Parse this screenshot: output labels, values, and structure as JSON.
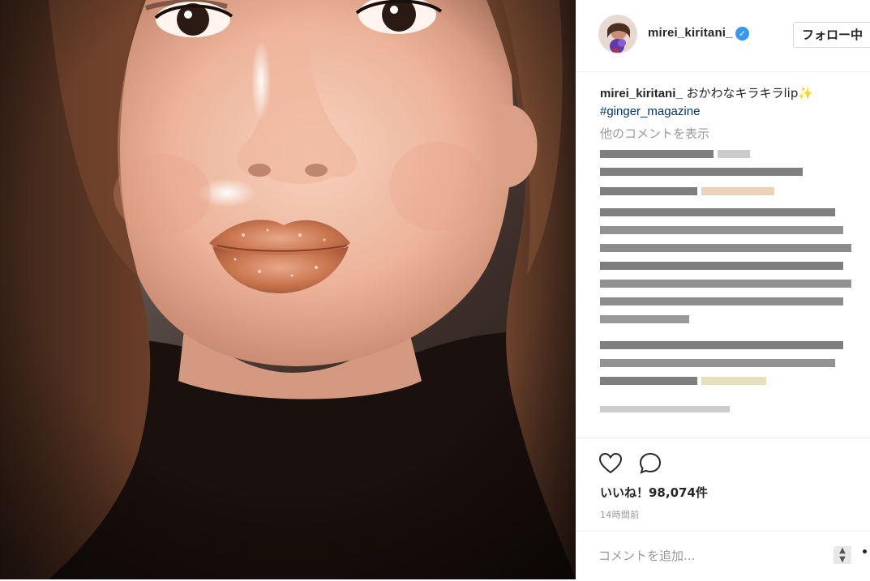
{
  "post": {
    "author": "mirei_kiritani_",
    "verified": true,
    "follow_label": "フォロー中",
    "caption_user": "mirei_kiritani_",
    "caption_text": " おかわなキラキラlip✨",
    "hashtag": "#ginger_magazine",
    "more_comments": "他のコメントを表示",
    "likes_label": "いいね！98,074件",
    "time": "14時間前",
    "add_comment_placeholder": "コメントを追加...",
    "more_options": "•••"
  },
  "icons": {
    "like": "heart-icon",
    "comment": "comment-bubble-icon",
    "verified": "verified-check-icon",
    "stepper": "stepper-arrows-icon"
  },
  "colors": {
    "link": "#003569",
    "verified": "#3897f0",
    "muted": "#999999",
    "text": "#262626",
    "border": "#efefef"
  }
}
